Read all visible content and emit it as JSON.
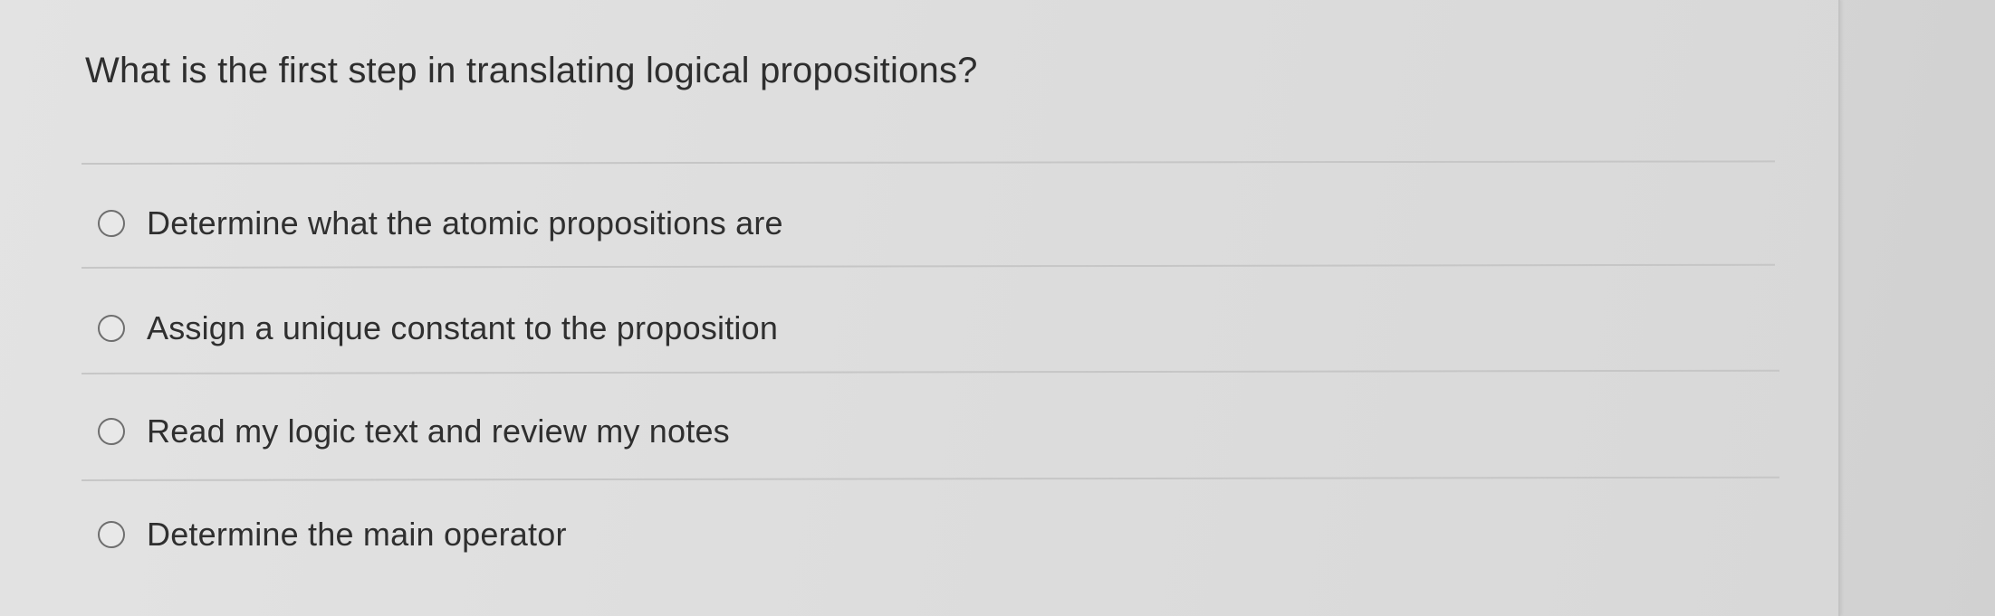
{
  "question": {
    "text": "What is the first step in translating logical propositions?"
  },
  "options": [
    {
      "label": "Determine what the atomic propositions are",
      "selected": false
    },
    {
      "label": "Assign a unique constant to the proposition",
      "selected": false
    },
    {
      "label": "Read my logic text and review my notes",
      "selected": false
    },
    {
      "label": "Determine the main operator",
      "selected": false
    }
  ],
  "colors": {
    "text": "#2e2e2e",
    "radio_border": "#6e6e6e",
    "divider": "#c6c6c6",
    "background": "#dcdcdc"
  }
}
